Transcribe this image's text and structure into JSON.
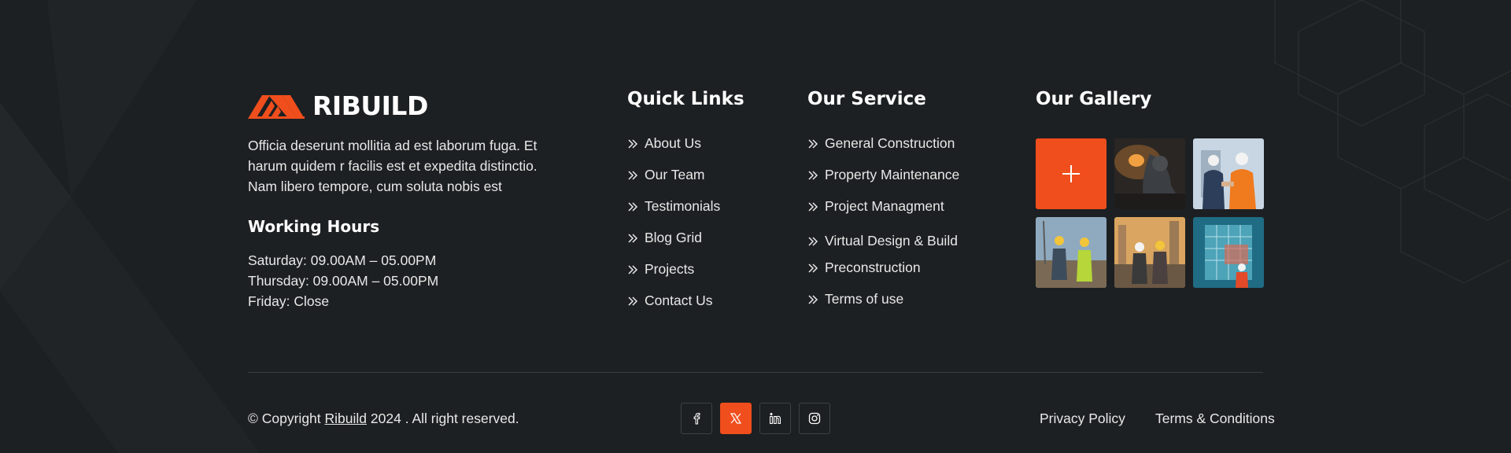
{
  "brand": {
    "name": "RIBUILD",
    "accent": "#f04e1d",
    "icon": "roof-logo-icon"
  },
  "about": {
    "text": "Officia deserunt mollitia ad est laborum fuga. Et harum quidem r facilis est et expedita distinctio. Nam libero tempore, cum soluta nobis est"
  },
  "hours": {
    "title": "Working Hours",
    "items": [
      "Saturday: 09.00AM – 05.00PM",
      "Thursday: 09.00AM – 05.00PM",
      "Friday: Close"
    ]
  },
  "quick_links": {
    "title": "Quick Links",
    "items": [
      "About Us",
      "Our Team",
      "Testimonials",
      "Blog Grid",
      "Projects",
      "Contact Us"
    ]
  },
  "services": {
    "title": "Our Service",
    "items": [
      "General Construction",
      "Property Maintenance",
      "Project Managment",
      "Virtual Design & Build",
      "Preconstruction",
      "Terms of use"
    ]
  },
  "gallery": {
    "title": "Our Gallery",
    "add_icon": "plus-icon",
    "images": [
      "welder-sparks-image",
      "handshake-engineers-image",
      "surveyor-site-image",
      "workers-sunset-image",
      "building-scaffold-image"
    ]
  },
  "footer": {
    "copyright_prefix": "© Copyright",
    "copyright_brand": "Ribuild",
    "copyright_suffix": "2024 . All right reserved.",
    "socials": [
      "facebook-icon",
      "x-icon",
      "linkedin-icon",
      "instagram-icon"
    ],
    "privacy": "Privacy Policy",
    "terms": "Terms & Conditions"
  },
  "colors": {
    "background": "#1d2022",
    "accent": "#f04e1d",
    "text": "#e8e8e8",
    "divider": "#3a3e41"
  }
}
